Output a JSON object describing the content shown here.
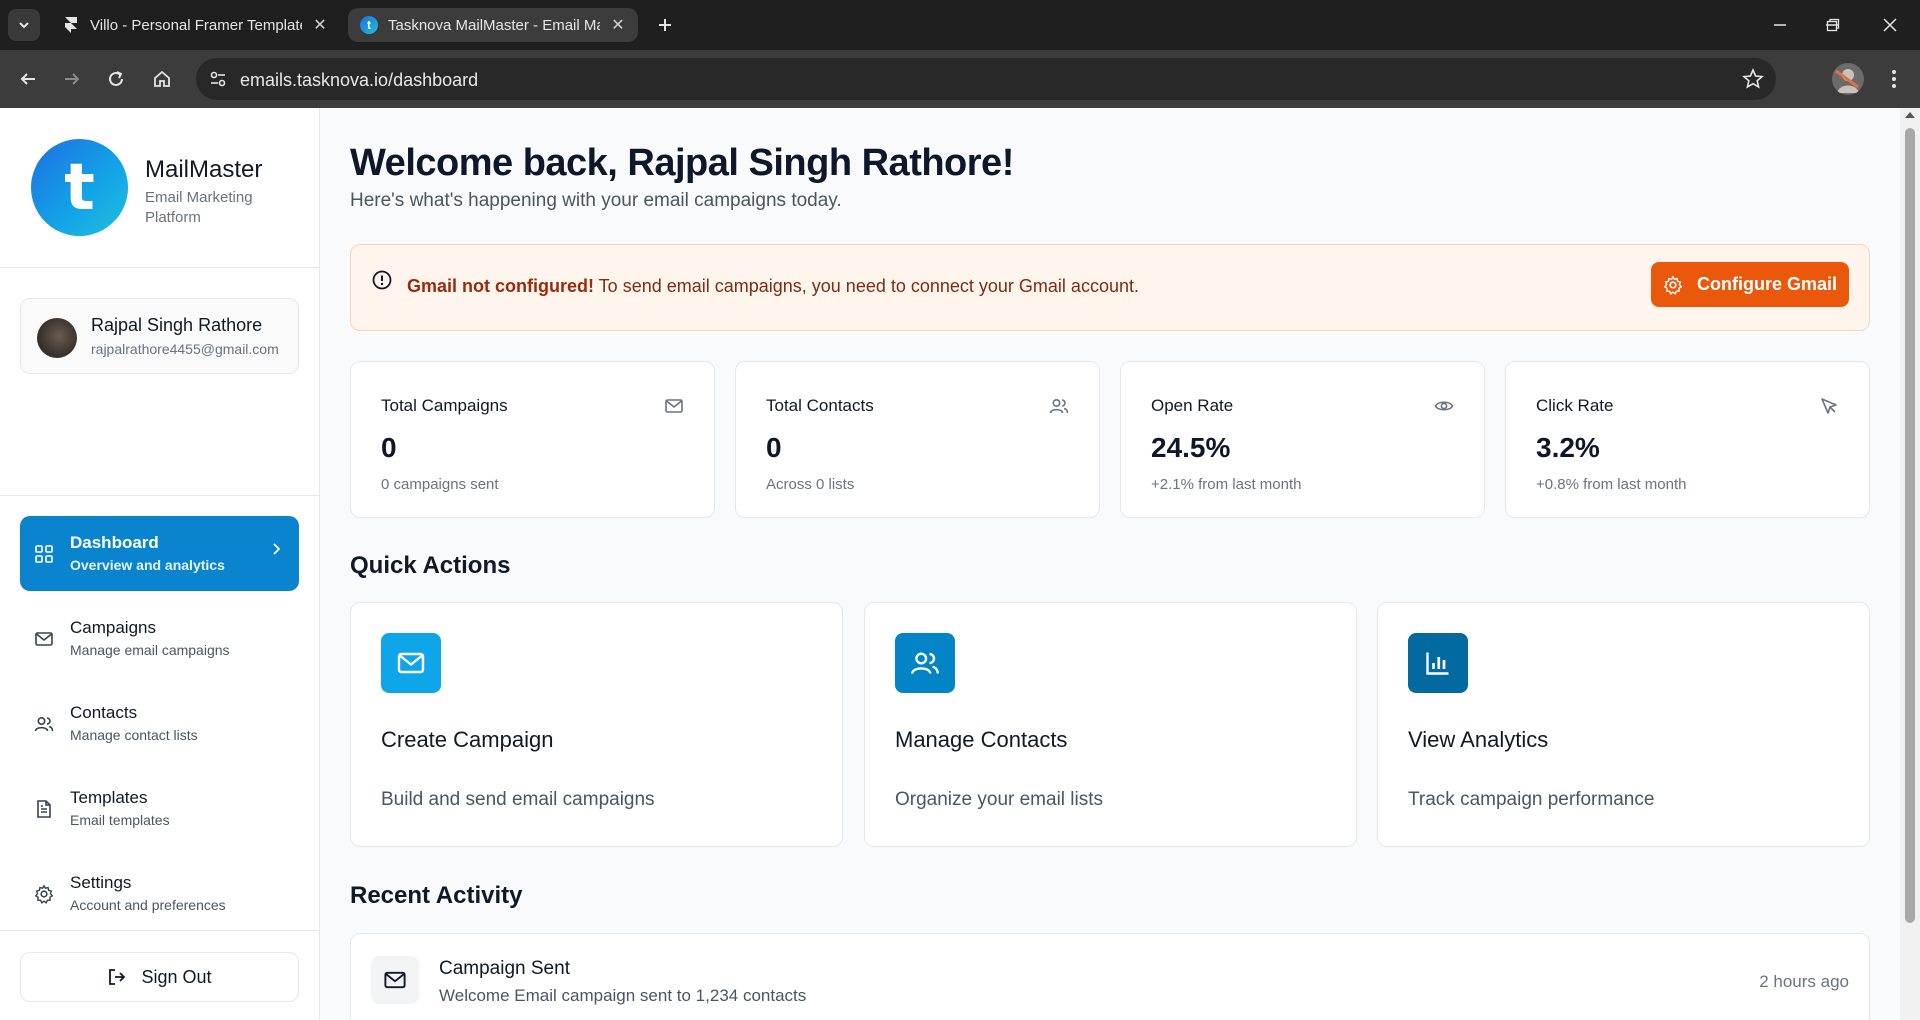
{
  "browser": {
    "tabs": [
      {
        "title": "Villo - Personal Framer Template",
        "active": false
      },
      {
        "title": "Tasknova MailMaster - Email Marketing",
        "active": true
      }
    ],
    "url_host": "emails.tasknova.io",
    "url_path": "/dashboard"
  },
  "sidebar": {
    "brand_letter": "t",
    "brand_name": "MailMaster",
    "brand_sub": "Email Marketing Platform",
    "user": {
      "name": "Rajpal Singh Rathore",
      "email": "rajpalrathore4455@gmail.com"
    },
    "nav": [
      {
        "title": "Dashboard",
        "sub": "Overview and analytics",
        "icon": "grid-icon",
        "active": true
      },
      {
        "title": "Campaigns",
        "sub": "Manage email campaigns",
        "icon": "mail-icon",
        "active": false
      },
      {
        "title": "Contacts",
        "sub": "Manage contact lists",
        "icon": "users-icon",
        "active": false
      },
      {
        "title": "Templates",
        "sub": "Email templates",
        "icon": "file-icon",
        "active": false
      },
      {
        "title": "Settings",
        "sub": "Account and preferences",
        "icon": "gear-icon",
        "active": false
      }
    ],
    "sign_out": "Sign Out"
  },
  "main": {
    "welcome": "Welcome back, Rajpal Singh Rathore!",
    "welcome_sub": "Here's what's happening with your email campaigns today.",
    "alert": {
      "strong": "Gmail not configured!",
      "text": " To send email campaigns, you need to connect your Gmail account.",
      "button": "Configure Gmail"
    },
    "stats": [
      {
        "title": "Total Campaigns",
        "value": "0",
        "sub": "0 campaigns sent",
        "icon": "mail-icon"
      },
      {
        "title": "Total Contacts",
        "value": "0",
        "sub": "Across 0 lists",
        "icon": "users-icon"
      },
      {
        "title": "Open Rate",
        "value": "24.5%",
        "sub": "+2.1% from last month",
        "icon": "eye-icon"
      },
      {
        "title": "Click Rate",
        "value": "3.2%",
        "sub": "+0.8% from last month",
        "icon": "cursor-icon"
      }
    ],
    "quick_actions_title": "Quick Actions",
    "quick_actions": [
      {
        "title": "Create Campaign",
        "sub": "Build and send email campaigns",
        "icon": "mail-icon",
        "color": "#0ea5e9"
      },
      {
        "title": "Manage Contacts",
        "sub": "Organize your email lists",
        "icon": "users-icon",
        "color": "#0284c7"
      },
      {
        "title": "View Analytics",
        "sub": "Track campaign performance",
        "icon": "bar-chart-icon",
        "color": "#0369a1"
      }
    ],
    "recent_title": "Recent Activity",
    "recent": [
      {
        "title": "Campaign Sent",
        "sub": "Welcome Email campaign sent to 1,234 contacts",
        "time": "2 hours ago"
      }
    ]
  },
  "colors": {
    "accent": "#0b84cf",
    "warning": "#ea580c",
    "alert_bg": "#fff5ec"
  }
}
